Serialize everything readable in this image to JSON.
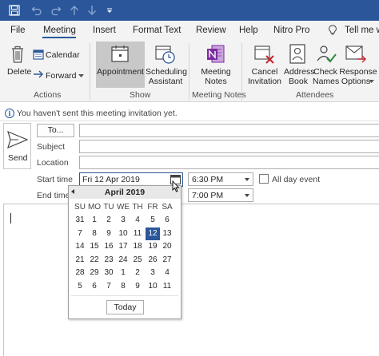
{
  "quick_access": {
    "icons": [
      "save-icon",
      "undo-icon",
      "redo-icon",
      "up-arrow-icon",
      "down-arrow-icon",
      "customize-icon"
    ]
  },
  "tabs": [
    {
      "label": "File"
    },
    {
      "label": "Meeting"
    },
    {
      "label": "Insert"
    },
    {
      "label": "Format Text"
    },
    {
      "label": "Review"
    },
    {
      "label": "Help"
    },
    {
      "label": "Nitro Pro"
    },
    {
      "label": "Tell me w"
    }
  ],
  "active_tab": "Meeting",
  "ribbon": {
    "actions": {
      "delete": "Delete",
      "calendar": "Calendar",
      "forward": "Forward",
      "group": "Actions"
    },
    "show": {
      "appointment": "Appointment",
      "scheduling_line1": "Scheduling",
      "scheduling_line2": "Assistant",
      "group": "Show"
    },
    "meeting_notes": {
      "line1": "Meeting",
      "line2": "Notes",
      "group": "Meeting Notes"
    },
    "attendees": {
      "cancel_line1": "Cancel",
      "cancel_line2": "Invitation",
      "address_line1": "Address",
      "address_line2": "Book",
      "check_line1": "Check",
      "check_line2": "Names",
      "response_line1": "Response",
      "response_line2": "Options",
      "group": "Attendees"
    }
  },
  "info_bar": {
    "message": "You haven't sent this meeting invitation yet."
  },
  "form": {
    "send_label": "Send",
    "to_label": "To...",
    "subject_label": "Subject",
    "location_label": "Location",
    "start_label": "Start time",
    "end_label": "End time",
    "start_date": "Fri 12 Apr 2019",
    "start_time": "6:30 PM",
    "end_time": "7:00 PM",
    "all_day_label": "All day event",
    "all_day_checked": false
  },
  "calendar": {
    "month_label": "April 2019",
    "weekdays": [
      "SU",
      "MO",
      "TU",
      "WE",
      "TH",
      "FR",
      "SA"
    ],
    "weeks": [
      [
        "31",
        "1",
        "2",
        "3",
        "4",
        "5",
        "6"
      ],
      [
        "7",
        "8",
        "9",
        "10",
        "11",
        "12",
        "13"
      ],
      [
        "14",
        "15",
        "16",
        "17",
        "18",
        "19",
        "20"
      ],
      [
        "21",
        "22",
        "23",
        "24",
        "25",
        "26",
        "27"
      ],
      [
        "28",
        "29",
        "30",
        "1",
        "2",
        "3",
        "4"
      ],
      [
        "5",
        "6",
        "7",
        "8",
        "9",
        "10",
        "11"
      ]
    ],
    "selected_day": "12",
    "today_label": "Today"
  },
  "colors": {
    "title_bar": "#2b579a",
    "accent": "#2b579a",
    "ribbon_bg": "#f3f3f3",
    "onenote_purple": "#7b2c9e",
    "cancel_red": "#c4262e"
  }
}
